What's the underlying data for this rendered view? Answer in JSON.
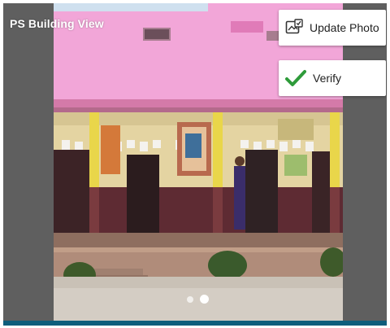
{
  "header": {
    "title": "PS Building View"
  },
  "actions": {
    "update_photo_label": "Update Photo",
    "update_photo_icon": "photo-edit-icon",
    "verify_label": "Verify",
    "verify_icon": "checkmark-icon",
    "verify_color": "#2e9b3a"
  },
  "carousel": {
    "page_count": 2,
    "active_page": 2
  },
  "colors": {
    "frame": "#5f5f5f",
    "accent_bar": "#0f5e7c",
    "building_wall": "#f2a6d8"
  }
}
